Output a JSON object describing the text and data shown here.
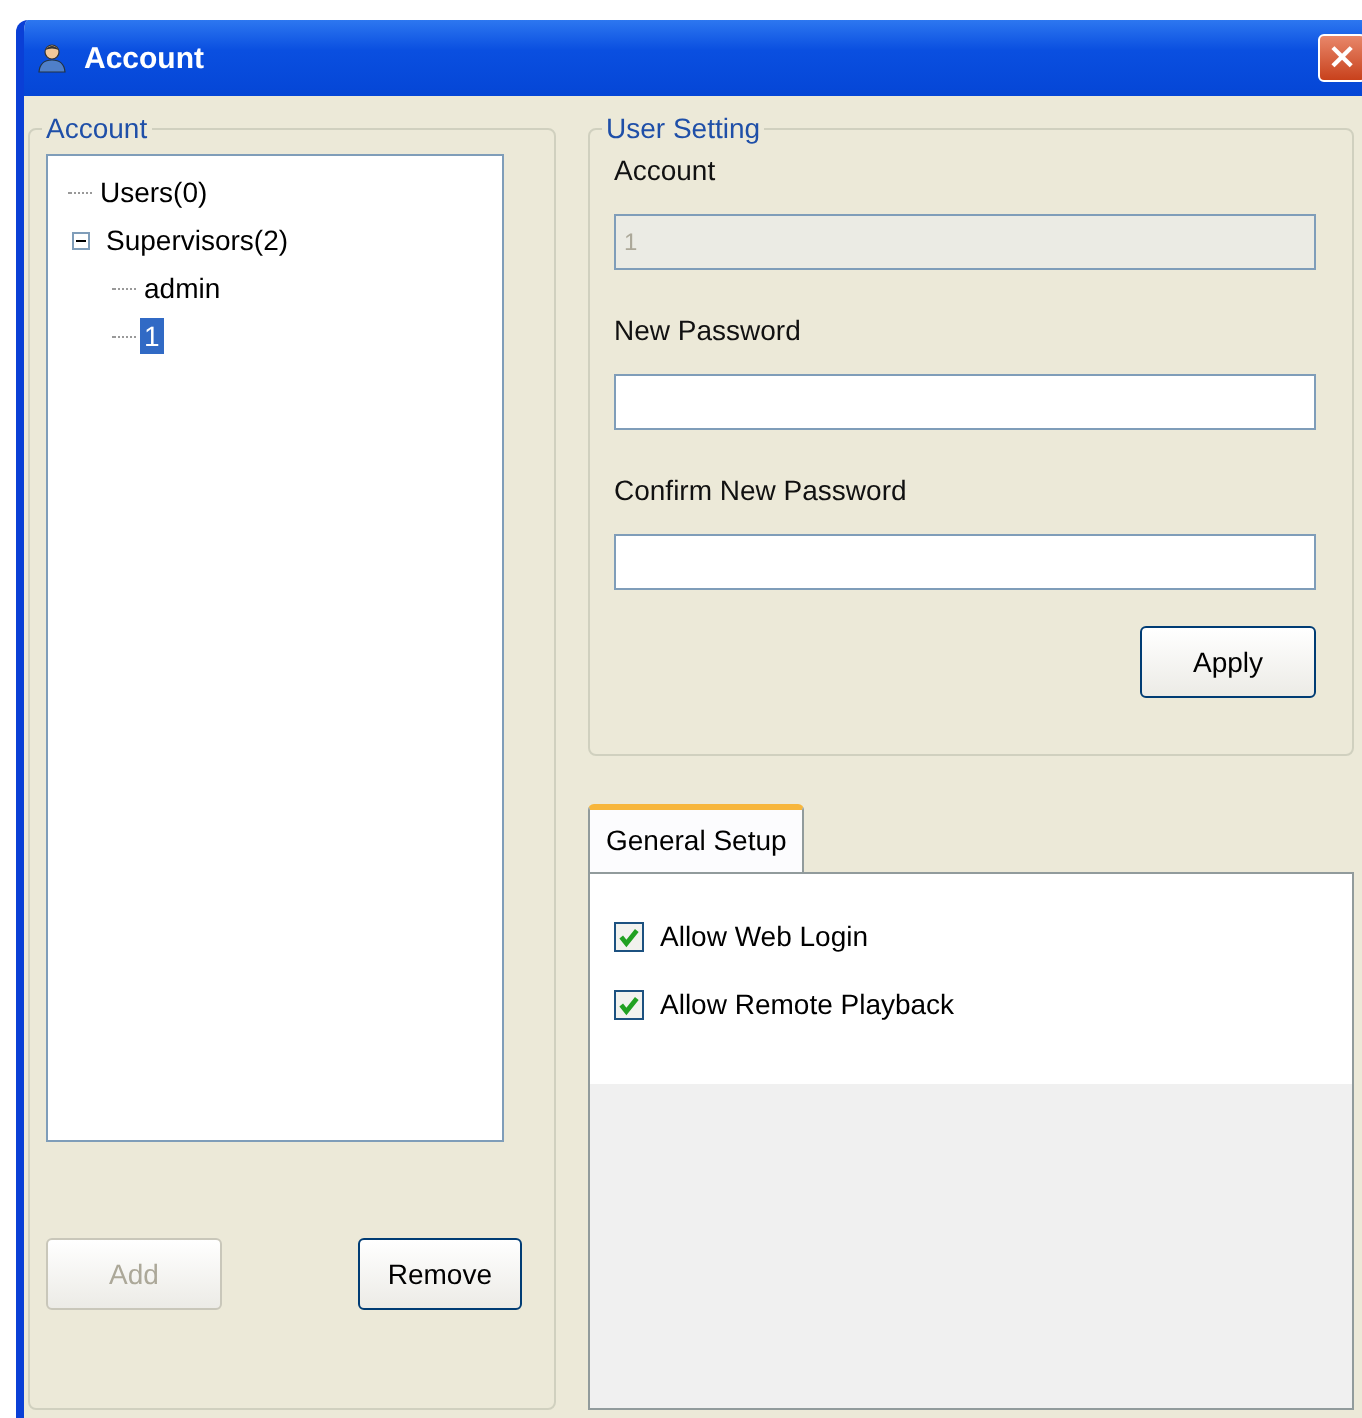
{
  "window": {
    "title": "Account",
    "close": "×"
  },
  "account_group": {
    "title": "Account",
    "tree": [
      {
        "label": "Users(0)",
        "selected": false
      },
      {
        "label": "Supervisors(2)",
        "selected": false,
        "expanded": true,
        "children": [
          {
            "label": "admin",
            "selected": false
          },
          {
            "label": "1",
            "selected": true
          }
        ]
      }
    ],
    "buttons": [
      {
        "label": "Add",
        "disabled": true
      },
      {
        "label": "Remove",
        "disabled": false
      }
    ]
  },
  "user_setting": {
    "title": "User Setting",
    "fields": [
      {
        "label": "Account",
        "value": "1",
        "disabled": true
      },
      {
        "label": "New Password",
        "disabled": false
      },
      {
        "label": "Confirm New Password",
        "disabled": false
      }
    ],
    "apply": "Apply"
  },
  "tabs": [
    {
      "label": "General Setup",
      "selected": true
    }
  ],
  "options": [
    {
      "label": "Allow Web Login",
      "checked": true
    },
    {
      "label": "Allow Remote Playback",
      "checked": true
    }
  ]
}
